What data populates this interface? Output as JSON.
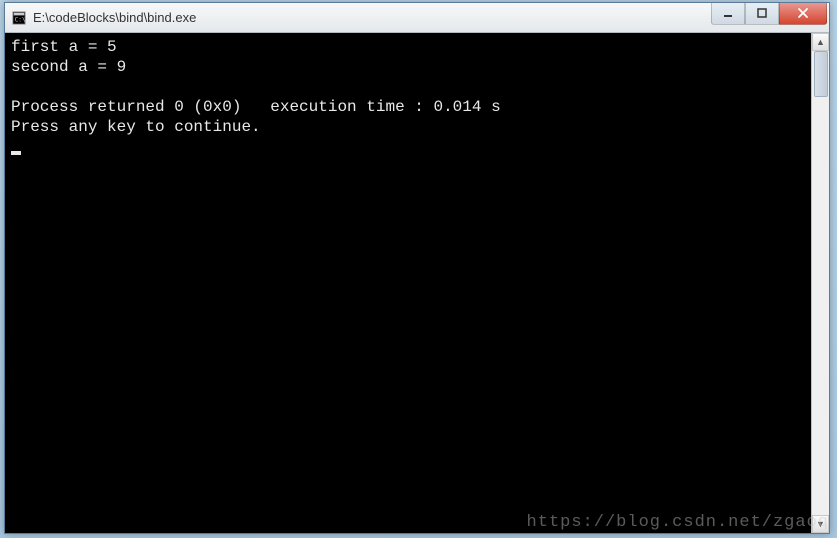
{
  "window": {
    "title": "E:\\codeBlocks\\bind\\bind.exe"
  },
  "console": {
    "lines": [
      "first a = 5",
      "second a = 9",
      "",
      "Process returned 0 (0x0)   execution time : 0.014 s",
      "Press any key to continue."
    ]
  },
  "watermark": "https://blog.csdn.net/zgaoq"
}
